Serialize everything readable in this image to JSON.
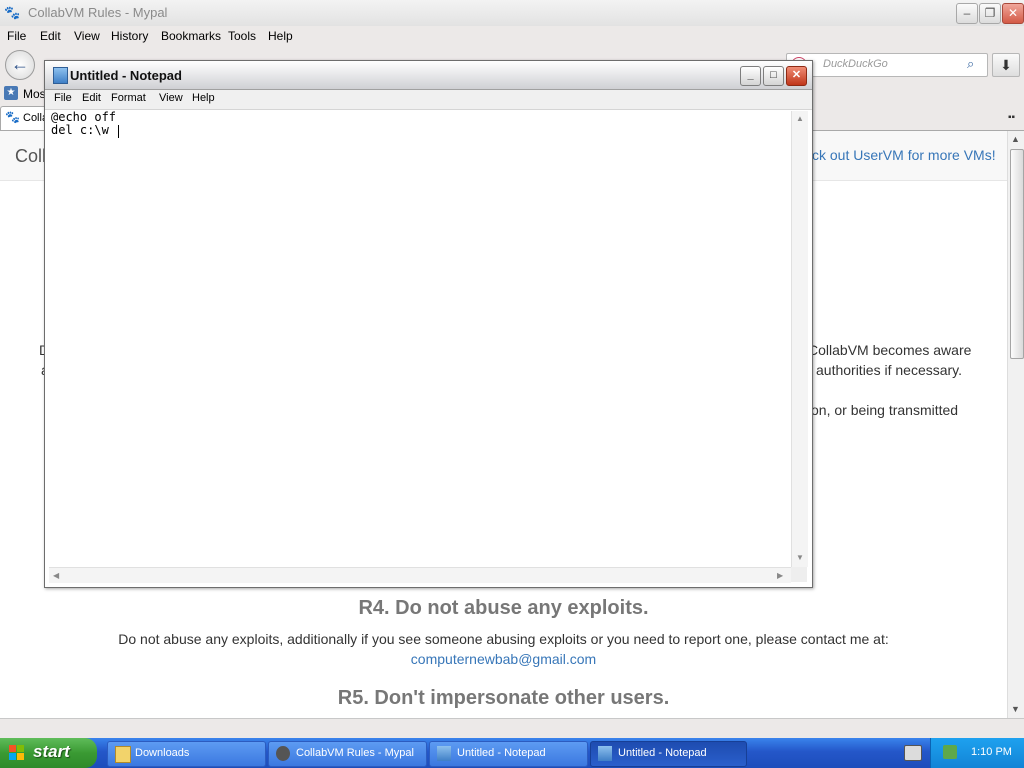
{
  "browser": {
    "title": "CollabVM Rules - Mypal",
    "menu": [
      "File",
      "Edit",
      "View",
      "History",
      "Bookmarks",
      "Tools",
      "Help"
    ],
    "search_placeholder": "DuckDuckGo",
    "bookmark_label": "Most",
    "tab_label": "Colla",
    "icons": {
      "back": "back-arrow-icon",
      "download": "download-icon",
      "search": "magnifier-icon"
    }
  },
  "page": {
    "site_title": "Coll",
    "uservm_link": "ck out UserVM for more VMs!",
    "fragments": {
      "left1": "D",
      "left2": "a",
      "right1": "CollabVM becomes aware",
      "right2": "authorities if necessary.",
      "right3": "on, or being transmitted"
    },
    "r4_heading": "R4. Do not abuse any exploits.",
    "r4_text": "Do not abuse any exploits, additionally if you see someone abusing exploits or you need to report one, please contact me at:",
    "r4_email": "computernewbab@gmail.com",
    "r5_heading": "R5. Don't impersonate other users."
  },
  "notepad": {
    "title": "Untitled - Notepad",
    "menu": [
      "File",
      "Edit",
      "Format",
      "View",
      "Help"
    ],
    "content": "@echo off\ndel c:\\w"
  },
  "taskbar": {
    "start_label": "start",
    "items": [
      {
        "label": "Downloads",
        "icon": "folder-icon"
      },
      {
        "label": "CollabVM Rules - Mypal",
        "icon": "mypal-icon"
      },
      {
        "label": "Untitled - Notepad",
        "icon": "notepad-icon"
      },
      {
        "label": "Untitled - Notepad",
        "icon": "notepad-icon"
      }
    ],
    "clock": "1:10 PM"
  },
  "colors": {
    "taskbar_blue": "#2457c9",
    "start_green": "#3a9a33",
    "link_blue": "#3776b8"
  }
}
